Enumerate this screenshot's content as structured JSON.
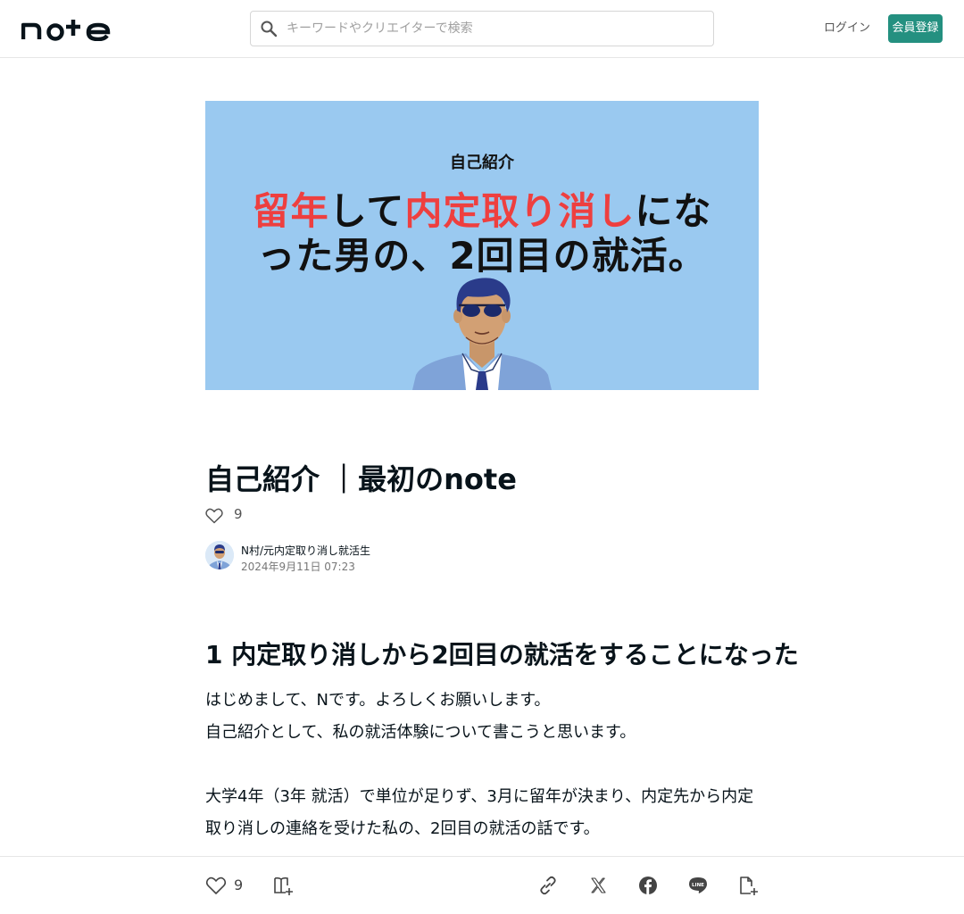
{
  "header": {
    "logo_text": "note",
    "search_placeholder": "キーワードやクリエイターで検索",
    "login_label": "ログイン",
    "signup_label": "会員登録"
  },
  "hero": {
    "tag": "自己紹介",
    "line1_a": "留年",
    "line1_b": "して",
    "line1_c": "内定取り消し",
    "line1_d": "にな",
    "line2": "った男の、2回目の就活。",
    "accent_color": "#ee3f3f",
    "background_color": "#9ac9f0"
  },
  "article": {
    "title": "自己紹介 ｜最初のnote",
    "likes": "9",
    "author_name": "N村/元内定取り消し就活生",
    "date": "2024年9月11日 07:23",
    "heading1": "1 内定取り消しから2回目の就活をすることになった",
    "paragraph1": "はじめまして、Nです。よろしくお願いします。",
    "paragraph2": "自己紹介として、私の就活体験について書こうと思います。",
    "paragraph3": "大学4年（3年 就活）で単位が足りず、3月に留年が決まり、内定先から内定取り消しの連絡を受けた私の、2回目の就活の話です。"
  },
  "footer": {
    "likes": "9"
  },
  "colors": {
    "brand_green": "#249080",
    "text": "#08131a"
  }
}
